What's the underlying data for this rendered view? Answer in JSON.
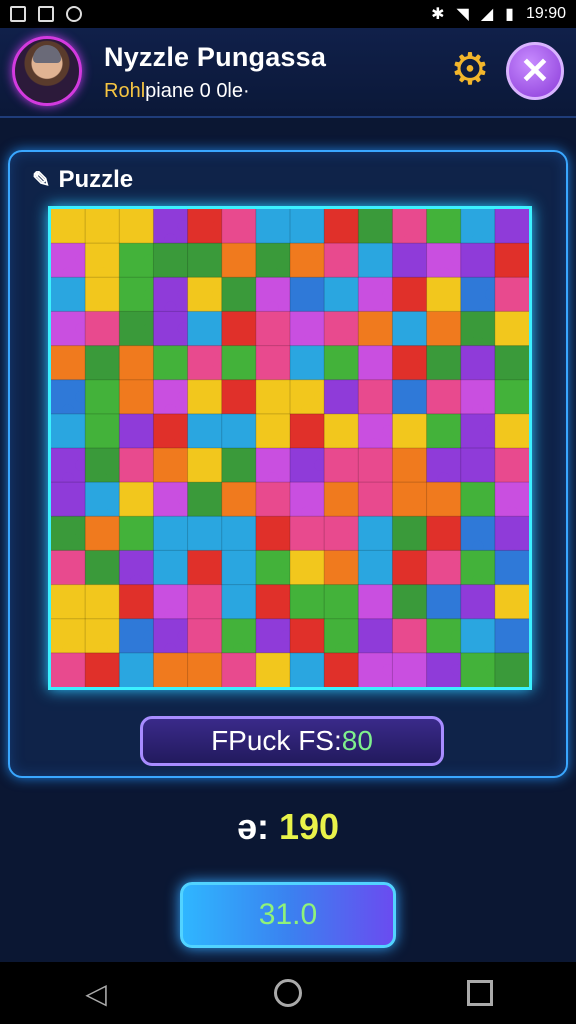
{
  "status_bar": {
    "time": "19:90",
    "left_icons": [
      "checkbox-icon",
      "image-icon",
      "shield-icon"
    ],
    "right_icons": [
      "bluetooth-icon",
      "wifi-icon",
      "signal-icon",
      "battery-icon"
    ]
  },
  "header": {
    "title": "Nyzzle Pungassa",
    "subtitle_accent": "Rohl",
    "subtitle_rest": "piane 0 0le·"
  },
  "panel": {
    "title": "Puzzle",
    "title_icon": "pin-icon"
  },
  "board": {
    "columns": 14,
    "rows": 14,
    "palette": [
      "#8f3bd9",
      "#2aa6e0",
      "#43b23a",
      "#f07a1e",
      "#f2c71d",
      "#e0302a",
      "#c94fe0",
      "#3a9a3a",
      "#2f79d8",
      "#e84a8e"
    ]
  },
  "score": {
    "label": "FPuck FS:",
    "value": "80"
  },
  "counter": {
    "label": "ə:",
    "value": "190"
  },
  "action_button": {
    "label": "31.0"
  },
  "colors": {
    "accent": "#3cf1ff",
    "background": "#0b1733"
  }
}
